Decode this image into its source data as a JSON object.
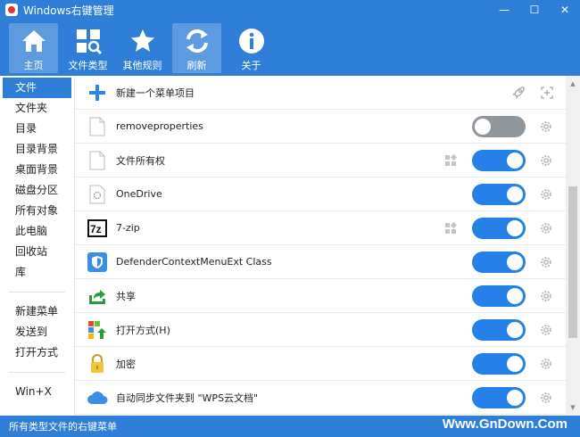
{
  "window": {
    "title": "Windows右键管理",
    "min": "—",
    "max": "☐",
    "close": "✕"
  },
  "toolbar": [
    {
      "label": "主页",
      "icon": "home-icon",
      "active": true
    },
    {
      "label": "文件类型",
      "icon": "file-types-icon",
      "active": false
    },
    {
      "label": "其他规则",
      "icon": "star-icon",
      "active": false
    },
    {
      "label": "刷新",
      "icon": "refresh-icon",
      "active": true
    },
    {
      "label": "关于",
      "icon": "info-icon",
      "active": false
    }
  ],
  "sidebar": {
    "group1": [
      "文件",
      "文件夹",
      "目录",
      "目录背景",
      "桌面背景",
      "磁盘分区",
      "所有对象",
      "此电脑",
      "回收站",
      "库"
    ],
    "group2": [
      "新建菜单",
      "发送到",
      "打开方式"
    ],
    "group3": [
      "Win+X"
    ],
    "active": "文件"
  },
  "list": {
    "header": "新建一个菜单项目",
    "rows": [
      {
        "label": "removeproperties",
        "icon": "blank-file-icon",
        "enabled": false,
        "tag": false
      },
      {
        "label": "文件所有权",
        "icon": "blank-file-icon",
        "enabled": true,
        "tag": true
      },
      {
        "label": "OneDrive",
        "icon": "onedrive-file-icon",
        "enabled": true,
        "tag": false
      },
      {
        "label": "7-zip",
        "icon": "7zip-icon",
        "enabled": true,
        "tag": true
      },
      {
        "label": "DefenderContextMenuExt Class",
        "icon": "defender-icon",
        "enabled": true,
        "tag": false
      },
      {
        "label": "共享",
        "icon": "share-icon",
        "enabled": true,
        "tag": false
      },
      {
        "label": "打开方式(H)",
        "icon": "open-with-icon",
        "enabled": true,
        "tag": false
      },
      {
        "label": "加密",
        "icon": "lock-icon",
        "enabled": true,
        "tag": false
      },
      {
        "label": "自动同步文件夹到 \"WPS云文档\"",
        "icon": "cloud-icon",
        "enabled": true,
        "tag": false
      }
    ]
  },
  "status": {
    "text": "所有类型文件的右键菜单",
    "watermark": "Www.GnDown.Com"
  }
}
